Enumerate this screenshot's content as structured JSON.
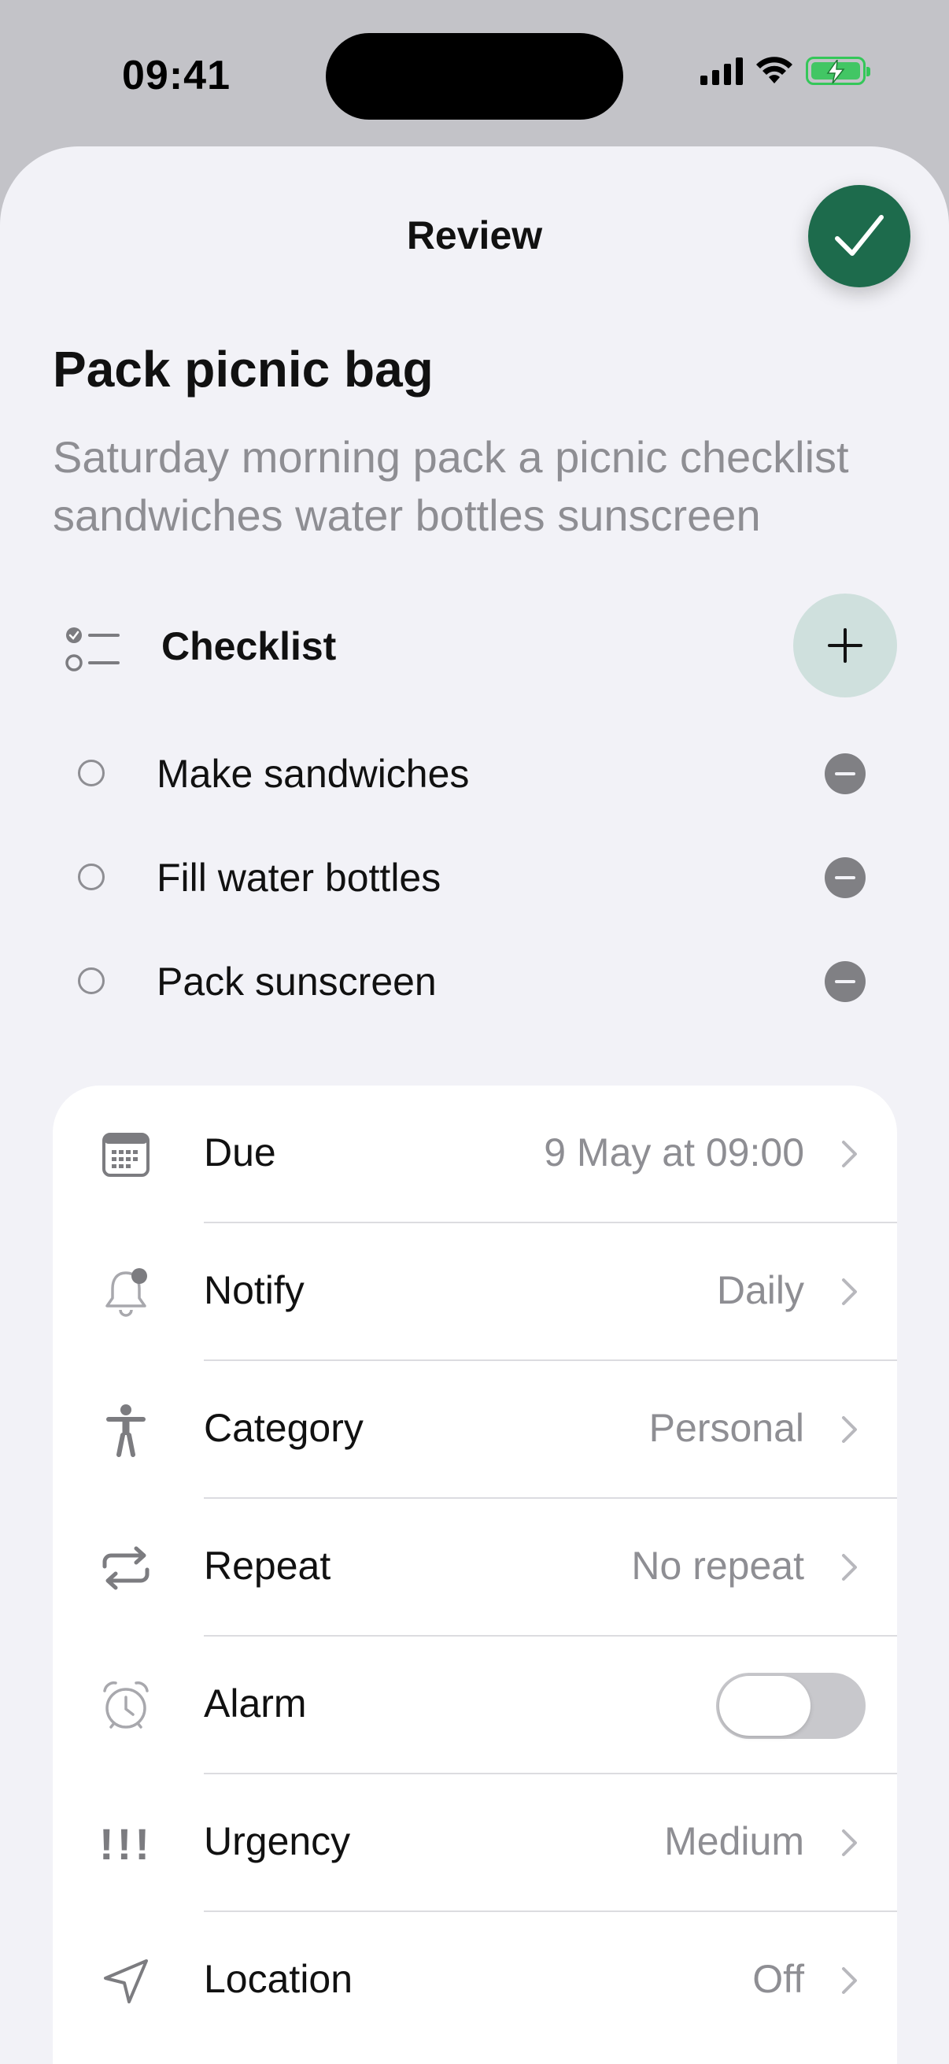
{
  "status_bar": {
    "time": "09:41"
  },
  "sheet": {
    "title": "Review"
  },
  "task": {
    "title": "Pack picnic bag",
    "description": "Saturday morning pack a picnic checklist sandwiches water bottles sunscreen"
  },
  "checklist": {
    "label": "Checklist",
    "items": [
      {
        "text": "Make sandwiches"
      },
      {
        "text": "Fill water bottles"
      },
      {
        "text": "Pack sunscreen"
      }
    ]
  },
  "details": [
    {
      "label": "Due",
      "value": "9 May at 09:00",
      "icon": "calendar-icon"
    },
    {
      "label": "Notify",
      "value": "Daily",
      "icon": "bell-icon"
    },
    {
      "label": "Category",
      "value": "Personal",
      "icon": "person-icon"
    },
    {
      "label": "Repeat",
      "value": "No repeat",
      "icon": "repeat-icon"
    },
    {
      "label": "Alarm",
      "value": "",
      "icon": "alarm-icon",
      "toggle_on": false
    },
    {
      "label": "Urgency",
      "value": "Medium",
      "icon": "urgency-icon",
      "glyph": "!!!"
    },
    {
      "label": "Location",
      "value": "Off",
      "icon": "location-arrow-icon"
    }
  ],
  "colors": {
    "accent": "#1d6b4c",
    "add_button_bg": "#cfe0dd",
    "background": "#f2f2f7",
    "secondary_text": "#8e8e93"
  }
}
